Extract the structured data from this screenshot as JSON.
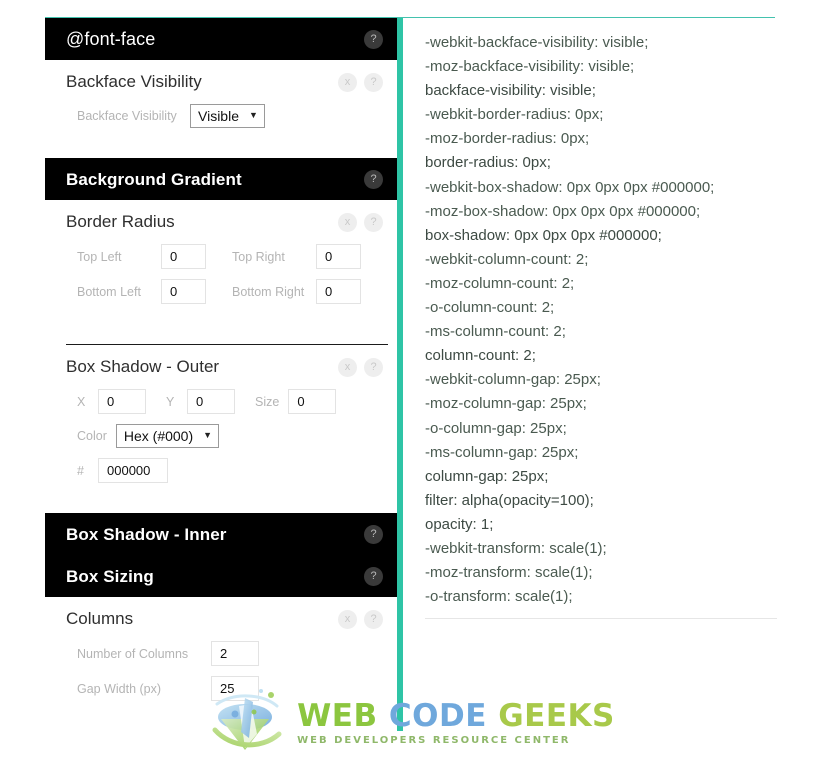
{
  "theme": {
    "accent_teal": "#2ec4a6",
    "header_bg": "#000000",
    "header_text": "#ffffff",
    "label_gray": "#b4b4b4",
    "css_text": "#3d4a43"
  },
  "sections": [
    {
      "id": "font-face",
      "type": "collapsed",
      "title": "@font-face",
      "help_label": "?"
    },
    {
      "id": "backface-visibility",
      "type": "open",
      "title": "Backface Visibility",
      "close_label": "x",
      "help_label": "?",
      "fields": [
        {
          "label": "Backface Visibility",
          "control": "select",
          "value": "Visible",
          "caret": "▼"
        }
      ]
    },
    {
      "id": "background-gradient",
      "type": "collapsed",
      "title": "Background Gradient",
      "help_label": "?"
    },
    {
      "id": "border-radius",
      "type": "open",
      "title": "Border Radius",
      "close_label": "x",
      "help_label": "?",
      "fields": [
        {
          "label": "Top Left",
          "value": "0"
        },
        {
          "label": "Top Right",
          "value": "0"
        },
        {
          "label": "Bottom Left",
          "value": "0"
        },
        {
          "label": "Bottom Right",
          "value": "0"
        }
      ]
    },
    {
      "id": "box-shadow-outer",
      "type": "open",
      "title": "Box Shadow - Outer",
      "close_label": "x",
      "help_label": "?",
      "fields": [
        {
          "label": "X",
          "value": "0"
        },
        {
          "label": "Y",
          "value": "0"
        },
        {
          "label": "Size",
          "value": "0"
        },
        {
          "label": "Color",
          "control": "select",
          "value": "Hex (#000)",
          "caret": "▼"
        },
        {
          "label": "#",
          "value": "000000"
        }
      ]
    },
    {
      "id": "box-shadow-inner",
      "type": "collapsed",
      "title": "Box Shadow - Inner",
      "help_label": "?"
    },
    {
      "id": "box-sizing",
      "type": "collapsed",
      "title": "Box Sizing",
      "help_label": "?"
    },
    {
      "id": "columns",
      "type": "open",
      "title": "Columns",
      "close_label": "x",
      "help_label": "?",
      "fields": [
        {
          "label": "Number of Columns",
          "value": "2"
        },
        {
          "label": "Gap Width (px)",
          "value": "25"
        }
      ]
    }
  ],
  "css_output": {
    "lines": [
      "-webkit-backface-visibility: visible;",
      "-moz-backface-visibility: visible;",
      "backface-visibility: visible;",
      "-webkit-border-radius: 0px;",
      "-moz-border-radius: 0px;",
      "border-radius: 0px;",
      "-webkit-box-shadow: 0px 0px 0px #000000;",
      "-moz-box-shadow: 0px 0px 0px #000000;",
      "box-shadow: 0px 0px 0px #000000;",
      "-webkit-column-count: 2;",
      "-moz-column-count: 2;",
      "-o-column-count: 2;",
      "-ms-column-count: 2;",
      "column-count: 2;",
      "-webkit-column-gap: 25px;",
      "-moz-column-gap: 25px;",
      "-o-column-gap: 25px;",
      "-ms-column-gap: 25px;",
      "column-gap: 25px;",
      "filter: alpha(opacity=100);",
      "opacity: 1;",
      "-webkit-transform: scale(1);",
      "-moz-transform: scale(1);",
      "-o-transform: scale(1);"
    ]
  },
  "footer": {
    "wordmark_parts": [
      {
        "text": "WEB",
        "color": "#8cc63f"
      },
      {
        "text": "CODE",
        "color": "#6fa8dc"
      },
      {
        "text": "GEEKS",
        "color": "#a8c94a"
      }
    ],
    "wordmark": "WEB CODE GEEKS",
    "tagline": "WEB DEVELOPERS RESOURCE CENTER"
  }
}
